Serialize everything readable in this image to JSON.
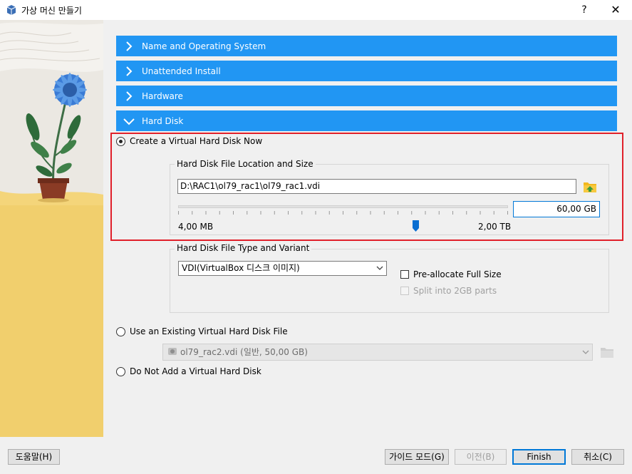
{
  "window": {
    "title": "가상 머신 만들기",
    "help_label": "?",
    "close_label": "✕"
  },
  "sections": [
    {
      "label": "Name and Operating System",
      "expanded": false
    },
    {
      "label": "Unattended Install",
      "expanded": false
    },
    {
      "label": "Hardware",
      "expanded": false
    },
    {
      "label": "Hard Disk",
      "expanded": true
    }
  ],
  "hard_disk": {
    "options": {
      "create_new": "Create a Virtual Hard Disk Now",
      "use_existing": "Use an Existing Virtual Hard Disk File",
      "do_not_add": "Do Not Add a Virtual Hard Disk"
    },
    "selected_option": "create_new",
    "location_group_title": "Hard Disk File Location and Size",
    "file_path": "D:\\RAC1\\ol79_rac1\\ol79_rac1.vdi",
    "size_value": "60,00 GB",
    "size_min_label": "4,00 MB",
    "size_max_label": "2,00 TB",
    "size_slider_fraction": 0.72,
    "type_group_title": "Hard Disk File Type and Variant",
    "type_selected": "VDI(VirtualBox 디스크 이미지)",
    "preallocate_label": "Pre-allocate Full Size",
    "split_label": "Split into 2GB parts",
    "existing_file_selected": "ol79_rac2.vdi (일반, 50,00 GB)"
  },
  "footer": {
    "help_button": "도움말(H)",
    "guided_mode_button": "가이드 모드(G)",
    "back_button": "이전(B)",
    "finish_button": "Finish",
    "cancel_button": "취소(C)"
  },
  "colors": {
    "section_header": "#2196f3",
    "highlight_border": "#e0202a",
    "default_button_border": "#0078d7"
  },
  "icons": {
    "app": "virtualbox-icon",
    "section_collapsed": "chevron-right-icon",
    "section_expanded": "chevron-down-icon",
    "folder": "folder-open-icon",
    "disk": "hard-disk-icon",
    "dropdown": "chevron-down-icon"
  }
}
